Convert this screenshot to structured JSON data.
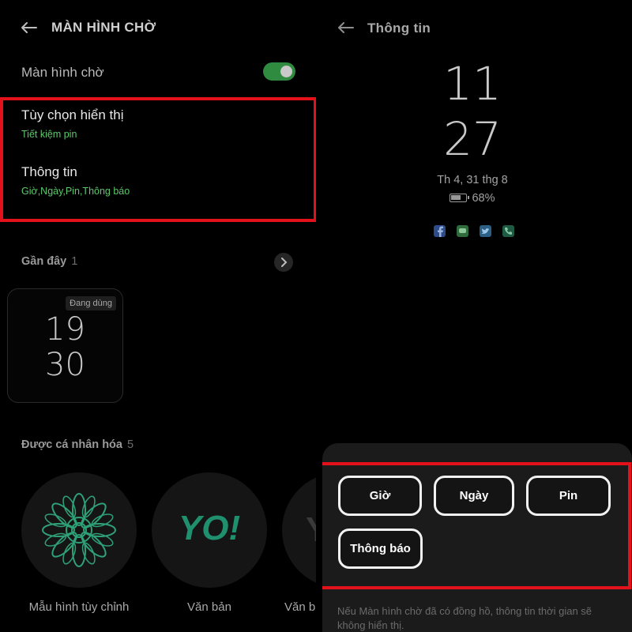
{
  "left_screen": {
    "header": {
      "back_icon": "back-arrow-icon",
      "title": "MÀN HÌNH CHỜ"
    },
    "toggle_row": {
      "label": "Màn hình chờ",
      "enabled": true,
      "accent": "#2e8b3f"
    },
    "display_options": {
      "label": "Tùy chọn hiển thị",
      "value": "Tiết kiệm pin"
    },
    "info": {
      "label": "Thông tin",
      "value": "Giờ,Ngày,Pin,Thông báo"
    },
    "recent": {
      "title": "Gần đây",
      "count": "1",
      "chevron_icon": "chevron-right-icon",
      "card": {
        "badge": "Đang dùng",
        "hour": "19",
        "minute": "30"
      }
    },
    "personalized": {
      "title": "Được cá nhân hóa",
      "count": "5",
      "items": [
        {
          "label": "Mẫu hình tùy chỉnh",
          "icon": "mandala-icon"
        },
        {
          "label": "Văn bản",
          "art": "YO!"
        },
        {
          "label": "Văn b",
          "art": "Y"
        }
      ]
    }
  },
  "right_screen": {
    "header": {
      "back_icon": "back-arrow-icon",
      "title": "Thông tin"
    },
    "preview": {
      "hour": "11",
      "minute": "27",
      "date": "Th 4, 31 thg 8",
      "battery_percent": "68%",
      "battery_level": 0.68,
      "notification_icons": [
        "facebook-icon",
        "messages-icon",
        "twitter-icon",
        "phone-icon"
      ]
    },
    "options": {
      "time": "Giờ",
      "date": "Ngày",
      "battery": "Pin",
      "notifications": "Thông báo"
    },
    "footnote": "Nếu Màn hình chờ đã có đồng hồ, thông tin thời gian sẽ không hiển thị."
  },
  "highlight_color": "#e3121a"
}
